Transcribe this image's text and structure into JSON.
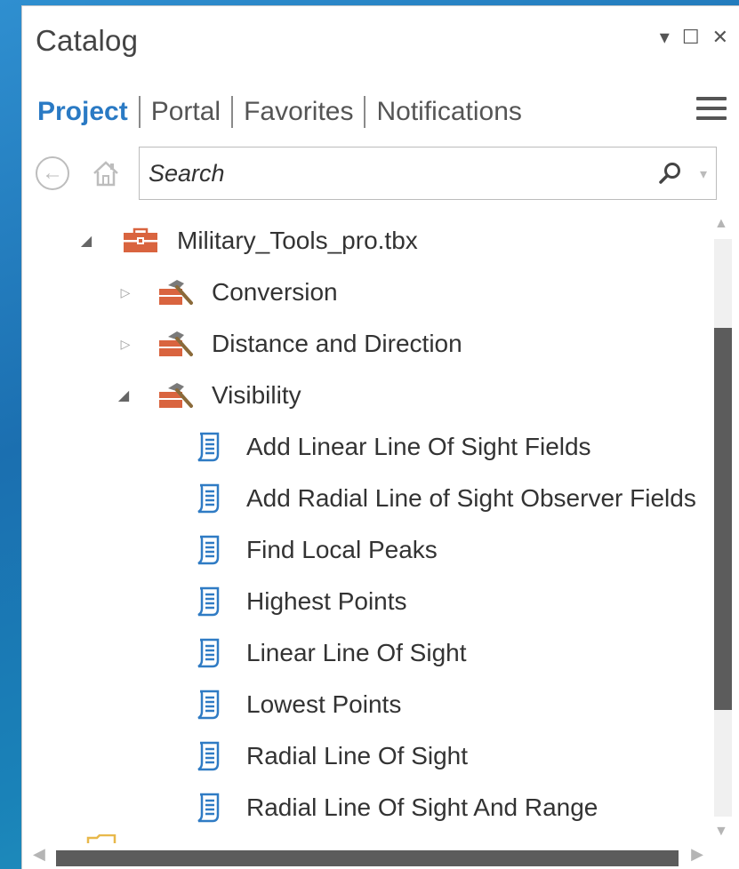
{
  "pane": {
    "title": "Catalog",
    "controls": {
      "dropdown": "▾",
      "maximize": "☐",
      "close": "✕"
    }
  },
  "tabs": [
    {
      "label": "Project",
      "active": true
    },
    {
      "label": "Portal",
      "active": false
    },
    {
      "label": "Favorites",
      "active": false
    },
    {
      "label": "Notifications",
      "active": false
    }
  ],
  "search": {
    "placeholder": "Search"
  },
  "tree": {
    "toolbox": {
      "label": "Military_Tools_pro.tbx",
      "expanded": true,
      "icon": "toolbox-icon"
    },
    "toolsets": [
      {
        "label": "Conversion",
        "expanded": false,
        "icon": "toolset-icon"
      },
      {
        "label": "Distance and Direction",
        "expanded": false,
        "icon": "toolset-icon"
      },
      {
        "label": "Visibility",
        "expanded": true,
        "icon": "toolset-icon"
      }
    ],
    "tools": [
      {
        "label": "Add Linear Line Of Sight  Fields",
        "icon": "script-tool-icon"
      },
      {
        "label": "Add Radial Line of Sight Observer Fields",
        "icon": "script-tool-icon"
      },
      {
        "label": "Find Local Peaks",
        "icon": "script-tool-icon"
      },
      {
        "label": "Highest Points",
        "icon": "script-tool-icon"
      },
      {
        "label": "Linear Line Of Sight",
        "icon": "script-tool-icon"
      },
      {
        "label": "Lowest Points",
        "icon": "script-tool-icon"
      },
      {
        "label": "Radial Line Of Sight",
        "icon": "script-tool-icon"
      },
      {
        "label": "Radial Line Of Sight And Range",
        "icon": "script-tool-icon"
      }
    ]
  },
  "colors": {
    "active_tab": "#2a7ac4",
    "toolbox_red": "#d9643f",
    "script_blue": "#2f7bc4",
    "scroll_thumb": "#5c5c5c"
  }
}
